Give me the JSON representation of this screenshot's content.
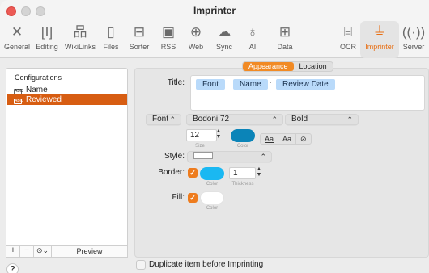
{
  "window": {
    "title": "Imprinter"
  },
  "toolbar": {
    "items": [
      {
        "label": "General",
        "icon": "tools-icon"
      },
      {
        "label": "Editing",
        "icon": "text-cursor-icon"
      },
      {
        "label": "WikiLinks",
        "icon": "network-icon"
      },
      {
        "label": "Files",
        "icon": "files-icon"
      },
      {
        "label": "Sorter",
        "icon": "sorter-icon"
      },
      {
        "label": "RSS",
        "icon": "rss-icon"
      },
      {
        "label": "Web",
        "icon": "globe-icon"
      },
      {
        "label": "Sync",
        "icon": "cloud-icon"
      },
      {
        "label": "AI",
        "icon": "lightbulb-icon"
      },
      {
        "label": "Data",
        "icon": "table-icon"
      },
      {
        "label": "OCR",
        "icon": "scan-text-icon"
      },
      {
        "label": "Imprinter",
        "icon": "stamp-icon"
      },
      {
        "label": "Server",
        "icon": "broadcast-icon"
      }
    ],
    "active": "Imprinter",
    "accent_color": "#e86f14"
  },
  "sidebar": {
    "header": "Configurations",
    "items": [
      {
        "label": "Name",
        "selected": false
      },
      {
        "label": "Reviewed",
        "selected": true
      }
    ],
    "selection_color": "#d75d12",
    "footer": {
      "add": "+",
      "remove": "−",
      "more": "⊙⌄",
      "preview": "Preview"
    }
  },
  "help": {
    "label": "?"
  },
  "tabs": {
    "appearance": "Appearance",
    "location": "Location",
    "active": "Appearance"
  },
  "form": {
    "title_label": "Title:",
    "title_tokens": [
      "Font",
      "Name",
      "Review Date"
    ],
    "title_separator": ":",
    "font_type_popup": "Font",
    "font_family": "Bodoni 72",
    "font_weight": "Bold",
    "font_size": "12",
    "size_caption": "Size",
    "color_caption": "Color",
    "font_color": "#0b84b8",
    "aa_buttons": [
      "Aa",
      "Aa",
      "⊘"
    ],
    "style_label": "Style:",
    "style_value": "",
    "border_label": "Border:",
    "border_checked": true,
    "border_color": "#1ab8f2",
    "border_thickness": "1",
    "thickness_caption": "Thickness",
    "fill_label": "Fill:",
    "fill_checked": true,
    "fill_color": "#ffffff"
  },
  "footer_option": {
    "label": "Duplicate item before Imprinting",
    "checked": false
  }
}
